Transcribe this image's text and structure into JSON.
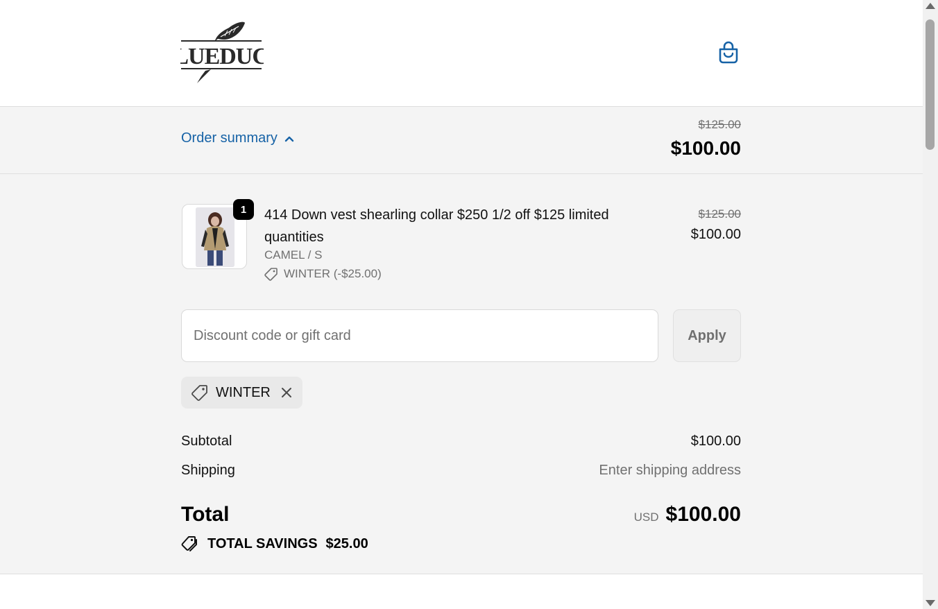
{
  "header": {
    "logo_text": "BlueDuck",
    "cart_icon": "shopping-bag-icon"
  },
  "order_summary_toggle": {
    "label": "Order summary",
    "icon": "chevron-up-icon",
    "compare_at_price": "$125.00",
    "price": "$100.00"
  },
  "line_item": {
    "quantity": "1",
    "title": "414 Down vest shearling collar $250 1/2 off $125 limited quantities",
    "variant": "CAMEL / S",
    "discount": "WINTER (-$25.00)",
    "compare_at_price": "$125.00",
    "price": "$100.00"
  },
  "discount_form": {
    "placeholder": "Discount code or gift card",
    "value": "",
    "apply_label": "Apply"
  },
  "applied_code": {
    "code": "WINTER"
  },
  "totals": {
    "subtotal_label": "Subtotal",
    "subtotal_value": "$100.00",
    "shipping_label": "Shipping",
    "shipping_value": "Enter shipping address",
    "total_label": "Total",
    "currency": "USD",
    "total_value": "$100.00",
    "savings_label": "TOTAL SAVINGS",
    "savings_value": "$25.00"
  },
  "colors": {
    "accent": "#1662a6",
    "panel_background": "#f4f4f4",
    "muted_text": "#707070"
  }
}
